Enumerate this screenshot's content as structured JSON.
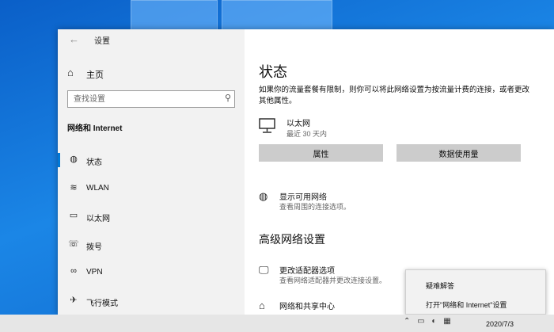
{
  "window": {
    "title": "设置"
  },
  "sidebar": {
    "home_label": "主页",
    "search_placeholder": "查找设置",
    "section_heading": "网络和 Internet",
    "items": [
      {
        "label": "状态",
        "icon": "globe-icon",
        "glyph": "◍",
        "active": true
      },
      {
        "label": "WLAN",
        "icon": "wifi-icon",
        "glyph": "≋"
      },
      {
        "label": "以太网",
        "icon": "ethernet-icon",
        "glyph": "▭"
      },
      {
        "label": "拨号",
        "icon": "dialup-icon",
        "glyph": "☏"
      },
      {
        "label": "VPN",
        "icon": "vpn-icon",
        "glyph": "∞"
      },
      {
        "label": "飞行模式",
        "icon": "airplane-icon",
        "glyph": "✈"
      }
    ]
  },
  "main": {
    "title": "状态",
    "description": "如果你的流量套餐有限制，则你可以将此网络设置为按流量计费的连接，或者更改其他属性。",
    "ethernet": {
      "name": "以太网",
      "sub": "最近 30 天内"
    },
    "buttons": {
      "properties": "属性",
      "data_usage": "数据使用量"
    },
    "available_networks": {
      "title": "显示可用网络",
      "sub": "查看周围的连接选项。"
    },
    "advanced_heading": "高级网络设置",
    "adapter": {
      "title": "更改适配器选项",
      "sub": "查看网络适配器并更改连接设置。"
    },
    "sharing": {
      "title": "网络和共享中心"
    }
  },
  "context_menu": {
    "items": [
      "疑难解答",
      "打开\"网络和 Internet\"设置"
    ]
  },
  "taskbar": {
    "clock_date": "2020/7/3"
  }
}
